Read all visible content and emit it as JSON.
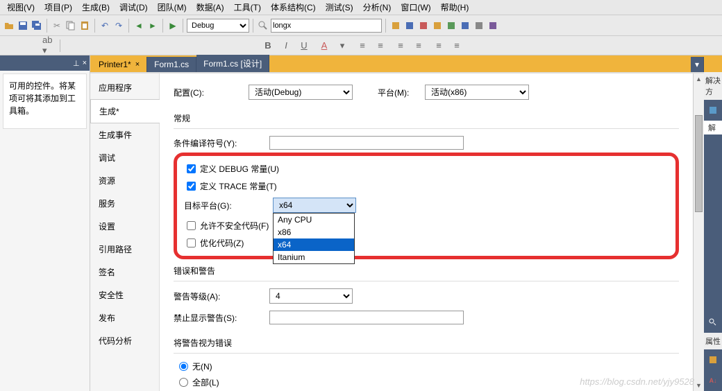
{
  "menu": {
    "items": [
      "视图(V)",
      "项目(P)",
      "生成(B)",
      "调试(D)",
      "团队(M)",
      "数据(A)",
      "工具(T)",
      "体系结构(C)",
      "测试(S)",
      "分析(N)",
      "窗口(W)",
      "帮助(H)"
    ]
  },
  "toolbar": {
    "config_select": "Debug",
    "platform_input": "longx"
  },
  "left": {
    "pin_title": "⊥",
    "close_title": "×",
    "text": "可用的控件。将某项可将其添加到工具箱。"
  },
  "tabs": [
    {
      "label": "Printer1*",
      "active": true
    },
    {
      "label": "Form1.cs",
      "active": false
    },
    {
      "label": "Form1.cs [设计]",
      "active": false
    }
  ],
  "prop_nav": [
    {
      "label": "应用程序",
      "active": false
    },
    {
      "label": "生成*",
      "active": true
    },
    {
      "label": "生成事件",
      "active": false
    },
    {
      "label": "调试",
      "active": false
    },
    {
      "label": "资源",
      "active": false
    },
    {
      "label": "服务",
      "active": false
    },
    {
      "label": "设置",
      "active": false
    },
    {
      "label": "引用路径",
      "active": false
    },
    {
      "label": "签名",
      "active": false
    },
    {
      "label": "安全性",
      "active": false
    },
    {
      "label": "发布",
      "active": false
    },
    {
      "label": "代码分析",
      "active": false
    }
  ],
  "props": {
    "config_label": "配置(C):",
    "config_value": "活动(Debug)",
    "platform_label": "平台(M):",
    "platform_value": "活动(x86)",
    "section_general": "常规",
    "cond_symbols_label": "条件编译符号(Y):",
    "cond_symbols_value": "",
    "debug_const": "定义 DEBUG 常量(U)",
    "trace_const": "定义 TRACE 常量(T)",
    "target_platform_label": "目标平台(G):",
    "target_platform_value": "x64",
    "target_options": [
      "Any CPU",
      "x86",
      "x64",
      "Itanium"
    ],
    "unsafe_code": "允许不安全代码(F)",
    "optimize_code": "优化代码(Z)",
    "section_warnings": "错误和警告",
    "warning_level_label": "警告等级(A):",
    "warning_level_value": "4",
    "suppress_warn_label": "禁止显示警告(S):",
    "suppress_warn_value": "",
    "section_treat": "将警告视为错误",
    "radio_none": "无(N)",
    "radio_all": "全部(L)"
  },
  "right": {
    "solution": "解决方",
    "solution_short": "解",
    "props_title": "属性"
  },
  "watermark": "https://blog.csdn.net/yjy9528"
}
